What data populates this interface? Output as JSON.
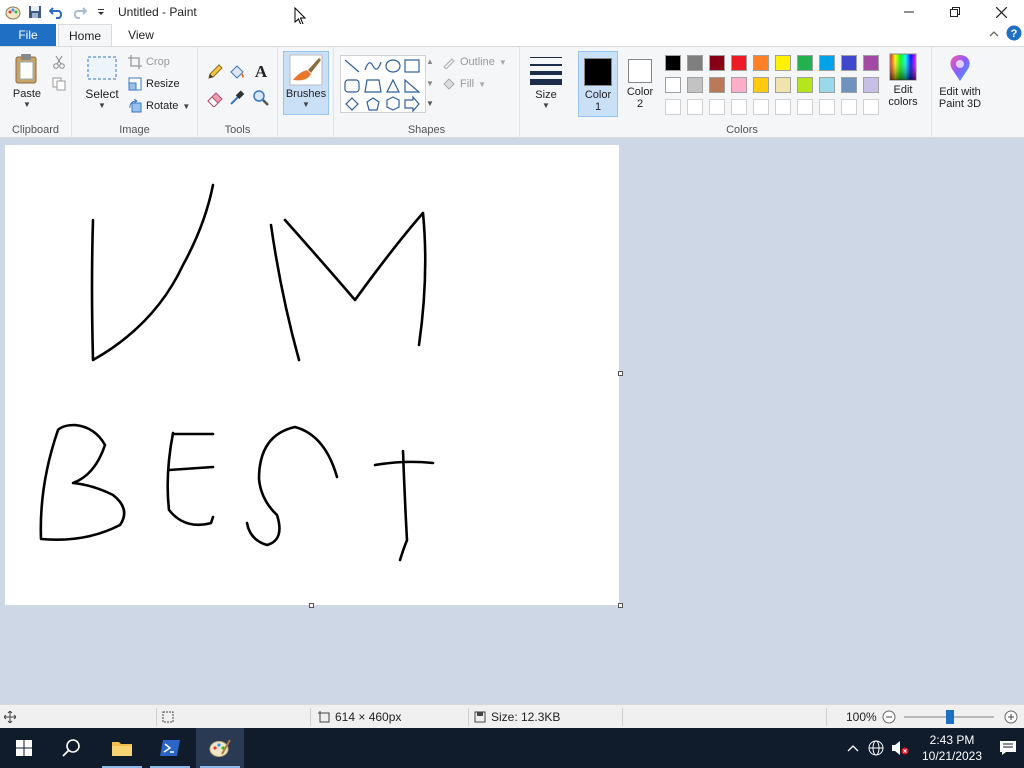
{
  "window": {
    "title": "Untitled - Paint"
  },
  "tabs": {
    "file": "File",
    "home": "Home",
    "view": "View"
  },
  "ribbon": {
    "clipboard": {
      "label": "Clipboard",
      "paste": "Paste"
    },
    "image": {
      "label": "Image",
      "select": "Select",
      "crop": "Crop",
      "resize": "Resize",
      "rotate": "Rotate"
    },
    "tools": {
      "label": "Tools"
    },
    "brushes": {
      "label": "Brushes"
    },
    "shapes": {
      "label": "Shapes",
      "outline": "Outline",
      "fill": "Fill"
    },
    "size": {
      "label": "Size"
    },
    "colors": {
      "label": "Colors",
      "color1": "Color\n1",
      "color1_line1": "Color",
      "color1_line2": "1",
      "color2_line1": "Color",
      "color2_line2": "2",
      "edit_colors_line1": "Edit",
      "edit_colors_line2": "colors",
      "paint3d_line1": "Edit with",
      "paint3d_line2": "Paint 3D",
      "color1_value": "#000000",
      "color2_value": "#ffffff",
      "palette_row1": [
        "#000000",
        "#7f7f7f",
        "#880015",
        "#ed1c24",
        "#ff7f27",
        "#fff200",
        "#22b14c",
        "#00a2e8",
        "#3f48cc",
        "#a349a4"
      ],
      "palette_row2": [
        "#ffffff",
        "#c3c3c3",
        "#b97a57",
        "#ffaec9",
        "#ffc90e",
        "#efe4b0",
        "#b5e61d",
        "#99d9ea",
        "#7092be",
        "#c8bfe7"
      ]
    }
  },
  "canvas": {
    "drawing_text": "VM BEST"
  },
  "status": {
    "dimensions": "614 × 460px",
    "size": "Size: 12.3KB",
    "zoom": "100%"
  },
  "taskbar": {
    "time": "2:43 PM",
    "date": "10/21/2023"
  }
}
